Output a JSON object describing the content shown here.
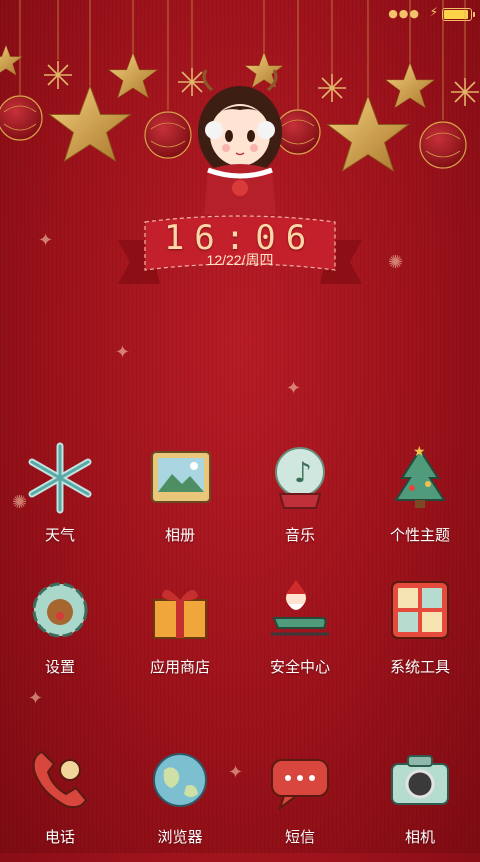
{
  "status_bar": {
    "signal_icon": "dots-icon",
    "charging_icon": "bolt-icon",
    "battery_icon": "battery-icon",
    "battery_level": 1.0,
    "accent": "#f2c36b"
  },
  "clock": {
    "time": "16:06",
    "date": "12/22/周四"
  },
  "apps": [
    {
      "label": "天气",
      "icon": "snowflake-icon"
    },
    {
      "label": "相册",
      "icon": "photo-album-icon"
    },
    {
      "label": "音乐",
      "icon": "music-globe-icon"
    },
    {
      "label": "个性主题",
      "icon": "christmas-tree-icon"
    },
    {
      "label": "设置",
      "icon": "reindeer-gear-icon"
    },
    {
      "label": "应用商店",
      "icon": "gift-box-icon"
    },
    {
      "label": "安全中心",
      "icon": "santa-sleigh-icon"
    },
    {
      "label": "系统工具",
      "icon": "toolbox-icon"
    },
    {
      "label": "电话",
      "icon": "phone-icon"
    },
    {
      "label": "浏览器",
      "icon": "globe-icon"
    },
    {
      "label": "短信",
      "icon": "message-icon"
    },
    {
      "label": "相机",
      "icon": "camera-icon"
    }
  ],
  "theme_colors": {
    "background": "#9c121b",
    "gold": "#d9a34a",
    "label": "#ffffff"
  }
}
